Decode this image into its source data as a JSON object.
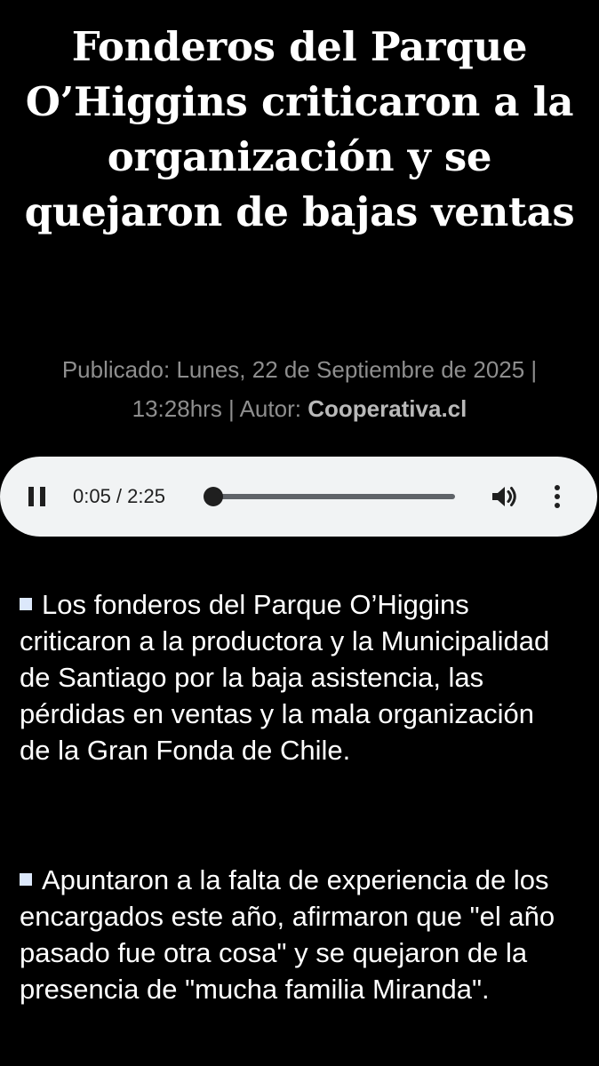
{
  "article": {
    "headline": "Fonderos del Parque O’Higgins criticaron a la organización y se quejaron de bajas ventas",
    "meta": {
      "published_prefix": "Publicado: Lunes, 22 de Septiembre de 2025 | 13:28hrs | Autor: ",
      "author": "Cooperativa.cl"
    },
    "bullets": [
      {
        "text": "Los fonderos del Parque O’Higgins criticaron a la productora y la Municipalidad de Santiago por la baja asistencia, las pérdidas en ventas y la mala organización de la Gran Fonda de Chile."
      },
      {
        "text": "Apuntaron a la falta de experiencia de los encargados este año, afirmaron que \"el año pasado fue otra cosa\" y se quejaron de la presencia de \"mucha familia Miranda\"."
      }
    ]
  },
  "audio_player": {
    "time_display": "0:05 / 2:25",
    "state": "playing",
    "progress_fraction": 0.035,
    "pause_icon": "pause-icon",
    "volume_icon": "volume-icon",
    "menu_icon": "more-vertical-icon"
  },
  "colors": {
    "background": "#000000",
    "headline": "#ffffff",
    "meta_text": "#8e8e8e",
    "meta_author": "#b9b9b9",
    "player_bg": "#f1f3f4",
    "bullet_square": "#dce8fb"
  }
}
